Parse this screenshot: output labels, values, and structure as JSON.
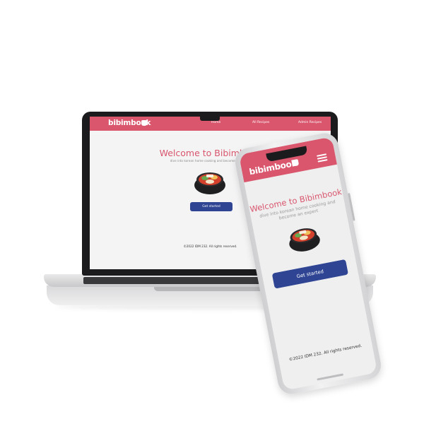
{
  "site": {
    "brand": "bibimbook",
    "nav": [
      "Home",
      "All Recipes",
      "Admin Recipes"
    ],
    "title": "Welcome to Bibimbook",
    "subtitle": "dive into korean home cooking and become an expert",
    "cta_label": "Get started",
    "footer": "©2022 IDM 232. All rights reserved."
  },
  "colors": {
    "brand": "#d9566d",
    "button": "#2f4594",
    "page_bg": "#f4f4f5"
  },
  "icons": {
    "brand_icon": "chef-hat-icon",
    "menu_icon": "hamburger-menu-icon",
    "hero_image": "bibimbap-bowl-image"
  }
}
